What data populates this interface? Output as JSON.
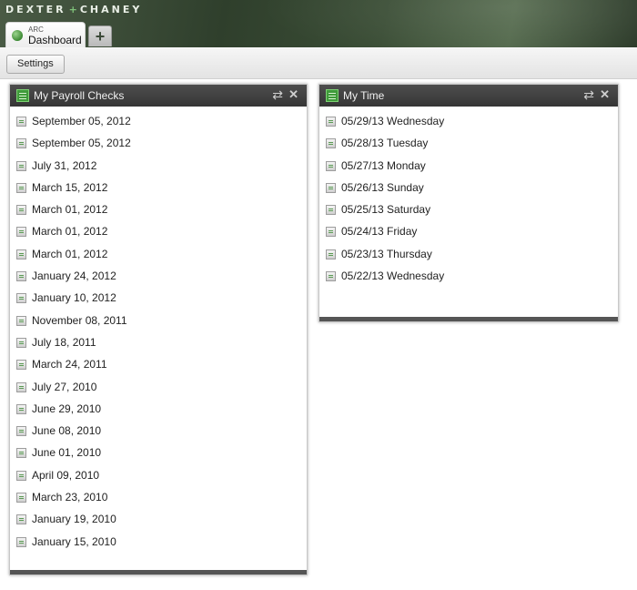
{
  "brand": {
    "left": "DEXTER",
    "plus": "+",
    "right": "CHANEY"
  },
  "tabs": [
    {
      "small": "ARC",
      "label": "Dashboard"
    }
  ],
  "add_tab_icon": "plus-icon",
  "toolbar": {
    "settings_label": "Settings"
  },
  "widgets": {
    "payroll": {
      "title": "My Payroll Checks",
      "icon": "table-icon",
      "items": [
        "September 05, 2012",
        "September 05, 2012",
        "July 31, 2012",
        "March 15, 2012",
        "March 01, 2012",
        "March 01, 2012",
        "March 01, 2012",
        "January 24, 2012",
        "January 10, 2012",
        "November 08, 2011",
        "July 18, 2011",
        "March 24, 2011",
        "July 27, 2010",
        "June 29, 2010",
        "June 08, 2010",
        "June 01, 2010",
        "April 09, 2010",
        "March 23, 2010",
        "January 19, 2010",
        "January 15, 2010"
      ]
    },
    "time": {
      "title": "My Time",
      "icon": "table-icon",
      "items": [
        "05/29/13 Wednesday",
        "05/28/13 Tuesday",
        "05/27/13 Monday",
        "05/26/13 Sunday",
        "05/25/13 Saturday",
        "05/24/13 Friday",
        "05/23/13 Thursday",
        "05/22/13 Wednesday"
      ]
    }
  },
  "colors": {
    "header_bg": "#3a4d35",
    "widget_header_bg": "#444444",
    "accent_green": "#3f9a3a"
  }
}
